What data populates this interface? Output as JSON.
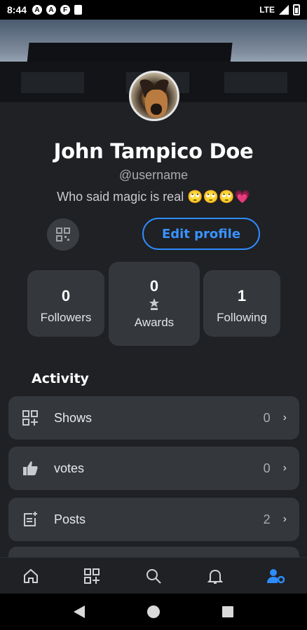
{
  "status_bar": {
    "time": "8:44",
    "network": "LTE",
    "app_icons": [
      "A",
      "A",
      "F"
    ]
  },
  "profile": {
    "name": "John Tampico Doe",
    "username": "@username",
    "bio": "Who said magic is real 🙄🙄🙄💗",
    "edit_label": "Edit profile"
  },
  "stats": {
    "followers": {
      "value": "0",
      "label": "Followers"
    },
    "awards": {
      "value": "0",
      "label": "Awards"
    },
    "following": {
      "value": "1",
      "label": "Following"
    }
  },
  "activity": {
    "title": "Activity",
    "items": [
      {
        "label": "Shows",
        "count": "0",
        "icon": "grid-add-icon"
      },
      {
        "label": "votes",
        "count": "0",
        "icon": "thumbs-up-icon"
      },
      {
        "label": "Posts",
        "count": "2",
        "icon": "post-add-icon"
      }
    ]
  },
  "bottom_nav": {
    "items": [
      "home-icon",
      "grid-add-icon",
      "search-icon",
      "bell-icon",
      "user-settings-icon"
    ],
    "active": "user-settings-icon"
  },
  "colors": {
    "accent": "#2f8cff",
    "background": "#1f2124",
    "card": "#34373c"
  }
}
